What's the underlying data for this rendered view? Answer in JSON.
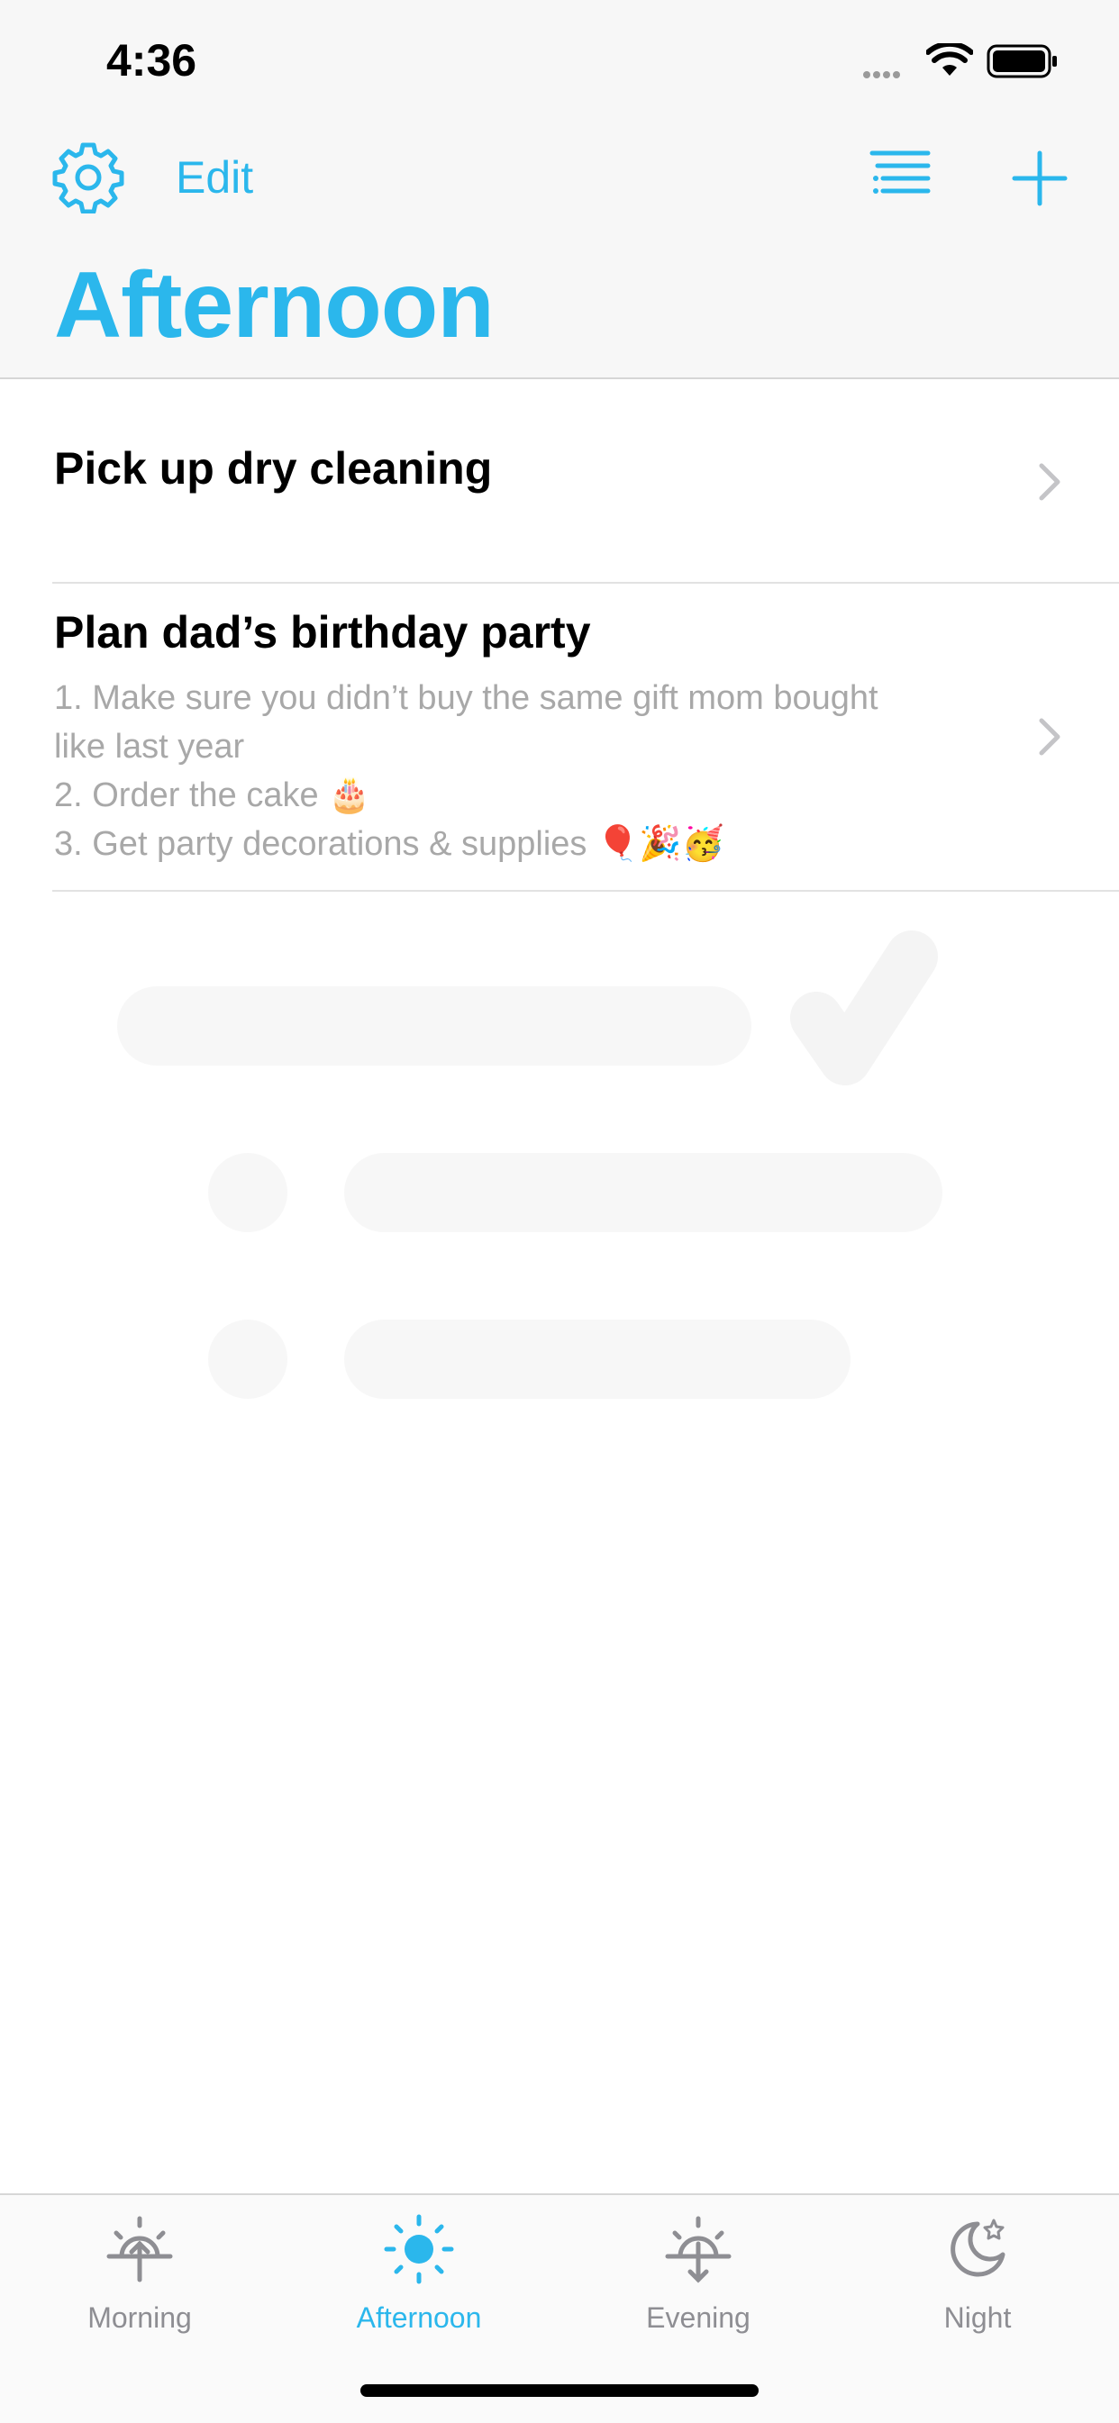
{
  "status": {
    "time": "4:36"
  },
  "header": {
    "settings_icon": "gear-icon",
    "edit_label": "Edit",
    "list_icon": "list-icon",
    "add_icon": "plus-icon",
    "title": "Afternoon"
  },
  "tasks": [
    {
      "title": "Pick up dry cleaning",
      "notes": []
    },
    {
      "title": "Plan dad’s birthday party",
      "notes": [
        "1. Make sure you didn’t buy the same gift mom bought",
        "like last year",
        "2. Order the cake 🎂",
        "3. Get party decorations & supplies 🎈🎉🥳"
      ]
    }
  ],
  "tabs": [
    {
      "label": "Morning",
      "icon": "sunrise-icon",
      "active": false
    },
    {
      "label": "Afternoon",
      "icon": "sun-icon",
      "active": true
    },
    {
      "label": "Evening",
      "icon": "sunset-icon",
      "active": false
    },
    {
      "label": "Night",
      "icon": "moon-icon",
      "active": false
    }
  ],
  "colors": {
    "accent": "#2bb7ec",
    "secondary_text": "#a8a8a8",
    "tab_inactive": "#8e8e93"
  }
}
